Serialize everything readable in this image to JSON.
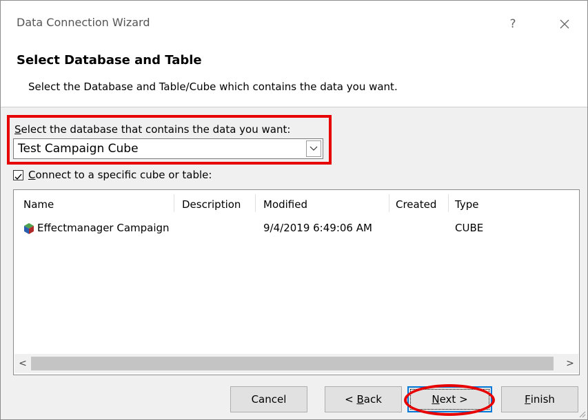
{
  "window": {
    "title": "Data Connection Wizard",
    "help_glyph": "?",
    "close_glyph": "✕"
  },
  "header": {
    "title": "Select Database and Table",
    "description": "Select the Database and Table/Cube which contains the data you want."
  },
  "database": {
    "label_accel": "S",
    "label_rest": "elect the database that contains the data you want:",
    "selected": "Test Campaign Cube"
  },
  "specific": {
    "checked": true,
    "label_accel": "C",
    "label_rest": "onnect to a specific cube or table:"
  },
  "table": {
    "columns": [
      "Name",
      "Description",
      "Modified",
      "Created",
      "Type"
    ],
    "rows": [
      {
        "name": "Effectmanager Campaign",
        "description": "",
        "modified": "9/4/2019 6:49:06 AM",
        "created": "",
        "type": "CUBE",
        "icon": "cube-icon"
      }
    ]
  },
  "scrollbar": {
    "left_glyph": "<",
    "right_glyph": ">"
  },
  "buttons": {
    "cancel": "Cancel",
    "back_accel": "B",
    "back_rest": "ack",
    "back_prefix": "< ",
    "next_accel": "N",
    "next_rest": "ext >",
    "finish_accel": "F",
    "finish_rest": "inish"
  },
  "colors": {
    "highlight_red": "#e60000",
    "focus_blue": "#0078d7",
    "dialog_bg": "#f0f0f0"
  }
}
